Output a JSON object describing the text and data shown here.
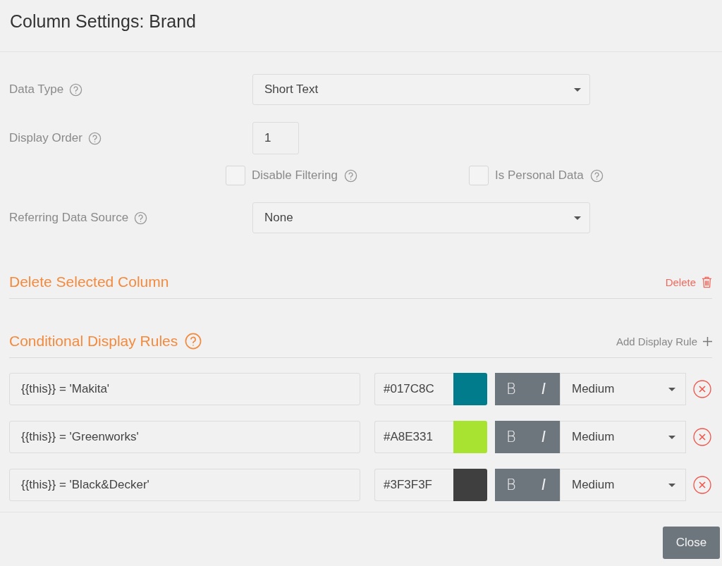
{
  "dialog": {
    "title": "Column Settings: Brand"
  },
  "fields": [
    {
      "kind": "select",
      "label": "Data Type",
      "value": "Short Text"
    },
    {
      "kind": "number",
      "label": "Display Order",
      "value": "1"
    },
    {
      "kind": "checkboxes",
      "options": [
        {
          "label": "Disable Filtering",
          "checked": false
        },
        {
          "label": "Is Personal Data",
          "checked": false
        }
      ]
    },
    {
      "kind": "select",
      "label": "Referring Data Source",
      "value": "None"
    }
  ],
  "delete_section": {
    "title": "Delete Selected Column",
    "action": "Delete"
  },
  "rules_section": {
    "title": "Conditional Display Rules",
    "action": "Add Display Rule"
  },
  "rules": [
    {
      "condition": "{{this}} = 'Makita'",
      "hex": "#017C8C",
      "color": "#017c8c",
      "style_buttons": [
        "B",
        "I"
      ],
      "size": "Medium"
    },
    {
      "condition": "{{this}} = 'Greenworks'",
      "hex": "#A8E331",
      "color": "#a8e331",
      "style_buttons": [
        "B",
        "I"
      ],
      "size": "Medium"
    },
    {
      "condition": "{{this}} = 'Black&Decker'",
      "hex": "#3F3F3F",
      "color": "#3f3f3f",
      "style_buttons": [
        "B",
        "I"
      ],
      "size": "Medium"
    }
  ],
  "footer": {
    "close": "Close"
  }
}
